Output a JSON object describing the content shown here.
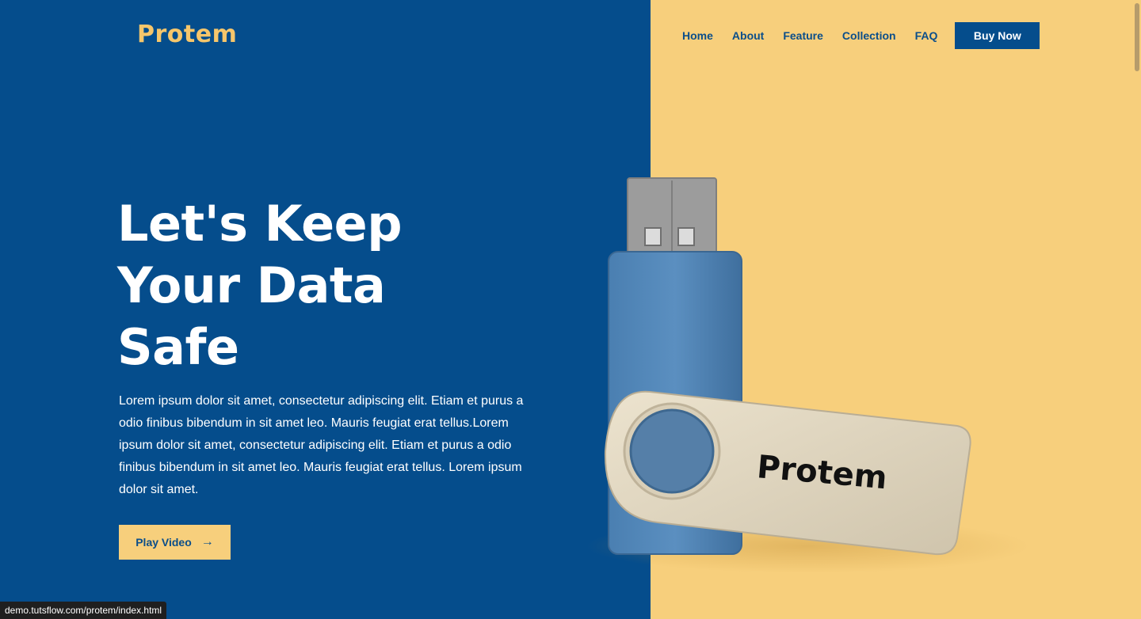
{
  "brand": {
    "logo_text": "Protem",
    "logo_color": "#f6c66b"
  },
  "colors": {
    "primary_blue": "#054d8c",
    "accent_yellow": "#f7cf7c"
  },
  "nav": {
    "items": [
      {
        "label": "Home"
      },
      {
        "label": "About"
      },
      {
        "label": "Feature"
      },
      {
        "label": "Collection"
      },
      {
        "label": "FAQ"
      }
    ],
    "cta_label": "Buy Now"
  },
  "hero": {
    "title_lines": [
      "Let's Keep",
      "Your Data",
      "Safe"
    ],
    "description": "Lorem ipsum dolor sit amet, consectetur adipiscing elit. Etiam et purus a odio finibus bibendum in sit amet leo. Mauris feugiat erat tellus.Lorem ipsum dolor sit amet, consectetur adipiscing elit. Etiam et purus a odio finibus bibendum in sit amet leo. Mauris feugiat erat tellus. Lorem ipsum dolor sit amet.",
    "play_button_label": "Play Video",
    "play_button_icon": "arrow-right-icon",
    "product_label": "Protem"
  },
  "status_bar": {
    "url": "demo.tutsflow.com/protem/index.html"
  }
}
